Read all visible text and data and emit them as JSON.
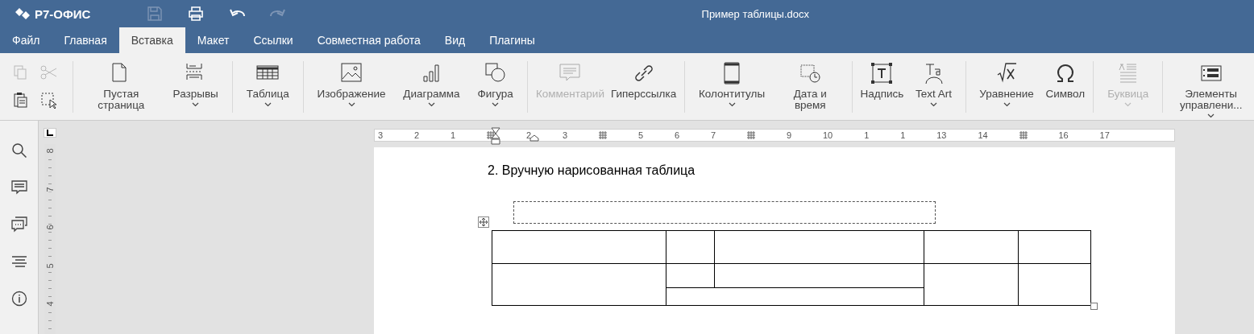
{
  "app": {
    "logo": "Р7-ОФИС"
  },
  "window": {
    "title": "Пример таблицы.docx"
  },
  "quick_actions": [
    {
      "kind": "save",
      "disabled": true
    },
    {
      "kind": "print",
      "disabled": false
    },
    {
      "kind": "undo",
      "disabled": false
    },
    {
      "kind": "redo",
      "disabled": true
    }
  ],
  "tabs": [
    {
      "label": "Файл",
      "selected": false
    },
    {
      "label": "Главная",
      "selected": false
    },
    {
      "label": "Вставка",
      "selected": true
    },
    {
      "label": "Макет",
      "selected": false
    },
    {
      "label": "Ссылки",
      "selected": false
    },
    {
      "label": "Совместная работа",
      "selected": false
    },
    {
      "label": "Вид",
      "selected": false
    },
    {
      "label": "Плагины",
      "selected": false
    }
  ],
  "clipboard": [
    {
      "kind": "copy",
      "disabled": true
    },
    {
      "kind": "cut",
      "disabled": true
    },
    {
      "kind": "paste",
      "disabled": false
    },
    {
      "kind": "select",
      "disabled": false
    }
  ],
  "toolbar_groups": [
    [
      {
        "kind": "page",
        "label": "Пустая страница",
        "dropdown": false,
        "disabled": false
      },
      {
        "kind": "breaks",
        "label": "Разрывы",
        "dropdown": true,
        "disabled": false
      }
    ],
    [
      {
        "kind": "table",
        "label": "Таблица",
        "dropdown": true,
        "disabled": false
      }
    ],
    [
      {
        "kind": "image",
        "label": "Изображение",
        "dropdown": true,
        "disabled": false
      },
      {
        "kind": "chart",
        "label": "Диаграмма",
        "dropdown": true,
        "disabled": false
      },
      {
        "kind": "shape",
        "label": "Фигура",
        "dropdown": true,
        "disabled": false
      }
    ],
    [
      {
        "kind": "comment",
        "label": "Комментарий",
        "dropdown": false,
        "disabled": true
      },
      {
        "kind": "link",
        "label": "Гиперссылка",
        "dropdown": false,
        "disabled": false
      }
    ],
    [
      {
        "kind": "header",
        "label": "Колонтитулы",
        "dropdown": true,
        "disabled": false
      },
      {
        "kind": "datetime",
        "label": "Дата и время",
        "dropdown": false,
        "disabled": false
      }
    ],
    [
      {
        "kind": "textbox",
        "label": "Надпись",
        "dropdown": false,
        "disabled": false
      },
      {
        "kind": "textart",
        "label": "Text Art",
        "dropdown": true,
        "disabled": false
      }
    ],
    [
      {
        "kind": "equation",
        "label": "Уравнение",
        "dropdown": true,
        "disabled": false
      },
      {
        "kind": "symbol",
        "label": "Символ",
        "dropdown": false,
        "disabled": false
      }
    ],
    [
      {
        "kind": "dropcap",
        "label": "Буквица",
        "dropdown": true,
        "disabled": true
      }
    ],
    [
      {
        "kind": "controls",
        "label": "Элементы управлени...",
        "dropdown": true,
        "disabled": false
      }
    ]
  ],
  "left_panel": [
    {
      "kind": "search"
    },
    {
      "kind": "comments"
    },
    {
      "kind": "chat"
    },
    {
      "kind": "navigation"
    },
    {
      "kind": "info"
    }
  ],
  "horizontal_ruler": [
    {
      "label": "3"
    },
    {
      "label": "2"
    },
    {
      "label": "1"
    },
    {
      "kind": "marker"
    },
    {
      "label": "2"
    },
    {
      "label": "3"
    },
    {
      "kind": "marker"
    },
    {
      "label": "5"
    },
    {
      "label": "6"
    },
    {
      "label": "7"
    },
    {
      "kind": "marker"
    },
    {
      "label": "9"
    },
    {
      "label": "10"
    },
    {
      "label": "1"
    },
    {
      "label": "1"
    },
    {
      "label": "13"
    },
    {
      "label": "14"
    },
    {
      "kind": "marker"
    },
    {
      "label": "16"
    },
    {
      "label": "17"
    }
  ],
  "vertical_ruler": [
    "8",
    "7",
    "6",
    "5",
    "4"
  ],
  "document": {
    "heading": "2. Вручную нарисованная таблица"
  }
}
